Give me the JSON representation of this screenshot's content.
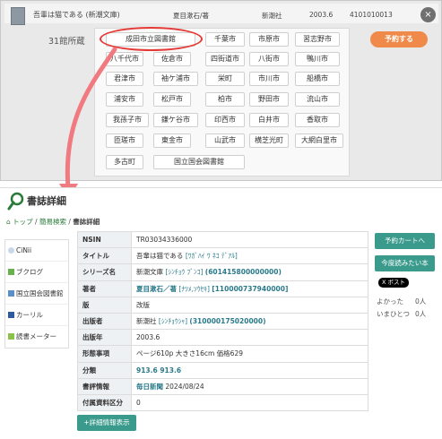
{
  "book": {
    "title": "吾輩は猫である (新潮文庫)",
    "author": "夏目漱石/著",
    "publisher": "新潮社",
    "date": "2003.6",
    "code": "4101010013"
  },
  "holdings": {
    "count_label": "31館所蔵",
    "reserve_label": "予約する",
    "close_glyph": "×"
  },
  "libraries": [
    "成田市立図書館",
    "千葉市",
    "市原市",
    "習志野市",
    "八千代市",
    "佐倉市",
    "四街道市",
    "八街市",
    "鴨川市",
    "君津市",
    "袖ケ浦市",
    "栄町",
    "市川市",
    "船橋市",
    "浦安市",
    "松戸市",
    "柏市",
    "野田市",
    "流山市",
    "我孫子市",
    "鎌ケ谷市",
    "印西市",
    "白井市",
    "香取市",
    "匝瑳市",
    "東金市",
    "山武市",
    "横芝光町",
    "大網白里市",
    "多古町",
    "国立国会図書館"
  ],
  "detail": {
    "heading": "書誌詳細",
    "breadcrumb": {
      "home": "トップ",
      "sep1": " / ",
      "search": "簡易検索",
      "sep2": " / ",
      "current": "書誌詳細"
    },
    "side_links": [
      "CiNii",
      "ブクログ",
      "国立国会図書館",
      "カーリル",
      "読書メーター"
    ],
    "rows": [
      {
        "key": "NSIN",
        "value": "TR03034336000",
        "kana": "",
        "link": ""
      },
      {
        "key": "タイトル",
        "value": "吾輩は猫である",
        "kana": "[ﾜｶﾞﾊｲ ﾜ ﾈｺ ﾃﾞｱﾙ]",
        "link": ""
      },
      {
        "key": "シリーズ名",
        "value": "新潮文庫",
        "kana": "[ｼﾝﾁｮｳ ﾌﾞﾝｺ]",
        "link": "(601415800000000)"
      },
      {
        "key": "著者",
        "value": "夏目漱石／著",
        "kana": "[ﾅﾂﾒ,ｿｳｾｷ]",
        "link": "[110000737940000]"
      },
      {
        "key": "版",
        "value": "改版",
        "kana": "",
        "link": ""
      },
      {
        "key": "出版者",
        "value": "新潮社",
        "kana": "[ｼﾝﾁｮｳｼｬ]",
        "link": "(310000175020000)"
      },
      {
        "key": "出版年",
        "value": "2003.6",
        "kana": "",
        "link": ""
      },
      {
        "key": "形態事項",
        "value": "ページ610p 大きさ16cm 価格629",
        "kana": "",
        "link": ""
      },
      {
        "key": "分類",
        "value": "913.6 913.6",
        "kana": "",
        "link": ""
      },
      {
        "key": "書評情報",
        "value": "毎日新聞",
        "kana": "",
        "link": "2024/08/24"
      },
      {
        "key": "付属資料区分",
        "value": "0",
        "kana": "",
        "link": ""
      }
    ],
    "expand_label": "+詳細情報表示",
    "reserve_cart_label": "予約カートへ",
    "want_to_read_label": "今度読みたい本",
    "x_post_label": "X ポスト",
    "counts": [
      {
        "label": "よかった",
        "value": "0人"
      },
      {
        "label": "いまひとつ",
        "value": "0人"
      }
    ]
  },
  "colors": {
    "accent_orange": "#f08a4b",
    "teal": "#3a9a8c",
    "highlight_red": "#e53935",
    "arrow_pink": "#f07a80"
  }
}
